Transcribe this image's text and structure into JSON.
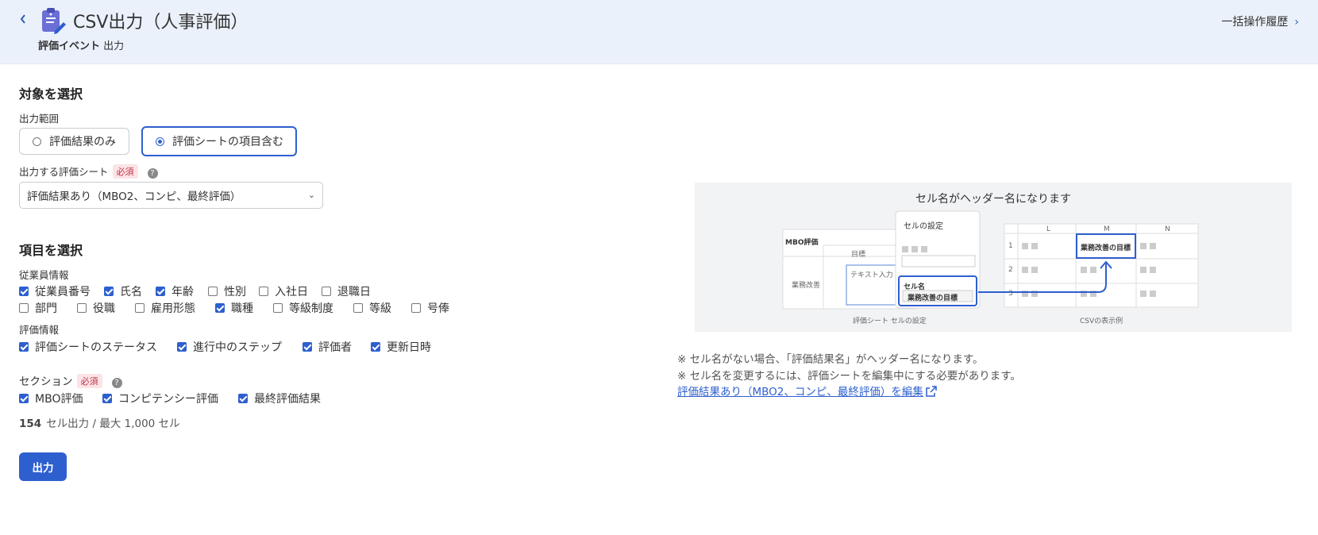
{
  "header": {
    "title": "CSV出力（人事評価）",
    "crumb_event": "評価イベント",
    "crumb_page": "出力",
    "history_label": "一括操作履歴",
    "back_icon": "chevron-left-icon",
    "app_icon": "clipboard-edit-icon"
  },
  "target": {
    "heading": "対象を選択",
    "range_label": "出力範囲",
    "range_options": [
      "評価結果のみ",
      "評価シートの項目含む"
    ],
    "range_selected": "評価シートの項目含む",
    "sheet_label": "出力する評価シート",
    "required": "必須",
    "sheet_value": "評価結果あり（MBO2、コンピ、最終評価）"
  },
  "items": {
    "heading": "項目を選択",
    "employee_label": "従業員情報",
    "employee": [
      {
        "label": "従業員番号",
        "checked": true
      },
      {
        "label": "氏名",
        "checked": true
      },
      {
        "label": "年齢",
        "checked": true
      },
      {
        "label": "性別",
        "checked": false
      },
      {
        "label": "入社日",
        "checked": false
      },
      {
        "label": "退職日",
        "checked": false
      },
      {
        "label": "部門",
        "checked": false
      },
      {
        "label": "役職",
        "checked": false
      },
      {
        "label": "雇用形態",
        "checked": false
      },
      {
        "label": "職種",
        "checked": true
      },
      {
        "label": "等級制度",
        "checked": false
      },
      {
        "label": "等級",
        "checked": false
      },
      {
        "label": "号俸",
        "checked": false
      }
    ],
    "eval_label": "評価情報",
    "eval": [
      {
        "label": "評価シートのステータス",
        "checked": true
      },
      {
        "label": "進行中のステップ",
        "checked": true
      },
      {
        "label": "評価者",
        "checked": true
      },
      {
        "label": "更新日時",
        "checked": true
      }
    ],
    "section_label": "セクション",
    "required": "必須",
    "sections": [
      {
        "label": "MBO評価",
        "checked": true
      },
      {
        "label": "コンピテンシー評価",
        "checked": true
      },
      {
        "label": "最終評価結果",
        "checked": true
      }
    ],
    "cell_count": "154",
    "cell_count_text": "セル出力 / 最大 1,000 セル",
    "output_button": "出力"
  },
  "illustration": {
    "title": "セル名がヘッダー名になります",
    "mbo_title": "MBO評価",
    "col_goal": "目標",
    "row_label": "業務改善",
    "text_input": "テキスト入力",
    "cell_settings": "セルの設定",
    "cell_name_label": "セル名",
    "cell_name_value": "業務改善の目標",
    "csv_cols": [
      "L",
      "M",
      "N"
    ],
    "csv_rows": [
      "1",
      "2",
      "3"
    ],
    "csv_header": "業務改善の目標",
    "caption_left": "評価シート セルの設定",
    "caption_right": "CSVの表示例"
  },
  "notes": {
    "line1": "※ セル名がない場合、「評価結果名」がヘッダー名になります。",
    "line2": "※ セル名を変更するには、評価シートを編集中にする必要があります。",
    "edit_link": "評価結果あり（MBO2、コンピ、最終評価）を編集",
    "external_icon": "external-link-icon"
  },
  "colors": {
    "accent": "#2e5fcf",
    "header_bg": "#ebf1fb",
    "required_bg": "#fbe3e6",
    "required_text": "#c0334b"
  }
}
